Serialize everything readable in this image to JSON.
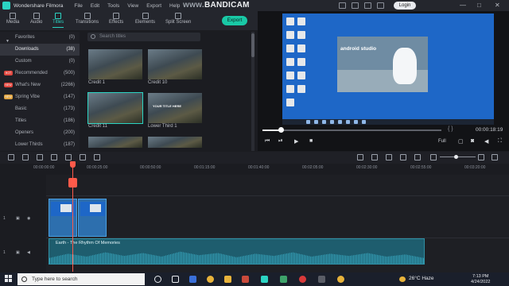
{
  "titlebar": {
    "app_name": "Wondershare Filmora",
    "menus": [
      "File",
      "Edit",
      "Tools",
      "View",
      "Export",
      "Help"
    ],
    "login": "Login"
  },
  "watermark": {
    "part1": "www.",
    "part2": "BANDICAM",
    ".com": ".com"
  },
  "toolbar": {
    "tabs": [
      "Media",
      "Audio",
      "Titles",
      "Transitions",
      "Effects",
      "Elements",
      "Split Screen"
    ],
    "export": "Export"
  },
  "sidebar": {
    "items": [
      {
        "label": "Favorites",
        "count": "(0)"
      },
      {
        "label": "Downloads",
        "count": "(38)"
      },
      {
        "label": "Custom",
        "count": "(0)"
      },
      {
        "label": "Recommended",
        "count": "(500)",
        "badge": "HOT"
      },
      {
        "label": "What's New",
        "count": "(2266)",
        "badge": "NEW"
      },
      {
        "label": "Spring Vibe",
        "count": "(147)",
        "badge": "NEW"
      },
      {
        "label": "Basic",
        "count": "(173)"
      },
      {
        "label": "Titles",
        "count": "(186)"
      },
      {
        "label": "Openers",
        "count": "(200)"
      },
      {
        "label": "Lower Thirds",
        "count": "(187)"
      }
    ]
  },
  "browser": {
    "search_placeholder": "Search titles",
    "items": [
      "Credit 1",
      "Credit 10",
      "Credit 11",
      "Lower Third 1"
    ],
    "thumb_texts": [
      "",
      "",
      "",
      "YOUR TITLE HERE"
    ]
  },
  "preview": {
    "studio_title": "android studio",
    "timecode": "00:00:18:19",
    "brackets": "{     }",
    "quality": "Full"
  },
  "timeline": {
    "ticks": [
      "00:00:00:00",
      "00:00:25:00",
      "00:00:50:00",
      "00:01:15:00",
      "00:01:40:00",
      "00:02:05:00",
      "00:02:30:00",
      "00:02:55:00",
      "00:03:20:00"
    ],
    "audio_clip": "Earth - The Rhythm Of Memories",
    "track_labels": [
      "1",
      "1"
    ]
  },
  "taskbar": {
    "search_placeholder": "Type here to search",
    "weather": "26°C  Haze",
    "time": "7:13 PM",
    "date": "4/24/2022"
  },
  "colors": {
    "accent": "#2bd4c3",
    "export": "#19c9a6",
    "playhead": "#ff5a4a",
    "desktop": "#1e67c7"
  }
}
